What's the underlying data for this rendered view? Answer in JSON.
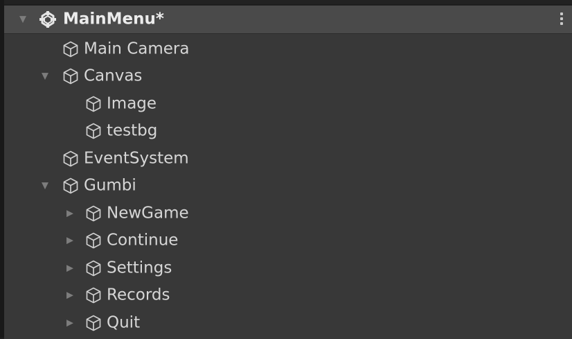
{
  "scene": {
    "title": "MainMenu*",
    "icon": "unity-scene-icon",
    "menu_icon": "kebab-menu-icon"
  },
  "hierarchy": {
    "items": [
      {
        "label": "Main Camera",
        "depth": 1,
        "expander": "none",
        "icon": "gameobject-cube-icon"
      },
      {
        "label": "Canvas",
        "depth": 1,
        "expander": "expanded",
        "icon": "gameobject-cube-icon"
      },
      {
        "label": "Image",
        "depth": 2,
        "expander": "none",
        "icon": "gameobject-cube-icon"
      },
      {
        "label": "testbg",
        "depth": 2,
        "expander": "none",
        "icon": "gameobject-cube-icon"
      },
      {
        "label": "EventSystem",
        "depth": 1,
        "expander": "none",
        "icon": "gameobject-cube-icon"
      },
      {
        "label": "Gumbi",
        "depth": 1,
        "expander": "expanded",
        "icon": "gameobject-cube-icon"
      },
      {
        "label": "NewGame",
        "depth": 2,
        "expander": "collapsed",
        "icon": "gameobject-cube-icon"
      },
      {
        "label": "Continue",
        "depth": 2,
        "expander": "collapsed",
        "icon": "gameobject-cube-icon"
      },
      {
        "label": "Settings",
        "depth": 2,
        "expander": "collapsed",
        "icon": "gameobject-cube-icon"
      },
      {
        "label": "Records",
        "depth": 2,
        "expander": "collapsed",
        "icon": "gameobject-cube-icon"
      },
      {
        "label": "Quit",
        "depth": 2,
        "expander": "collapsed",
        "icon": "gameobject-cube-icon"
      }
    ]
  },
  "colors": {
    "panel_background": "#383838",
    "header_background": "#4a4a4a",
    "text": "#d6d6d6",
    "arrow": "#7d7d7d"
  }
}
